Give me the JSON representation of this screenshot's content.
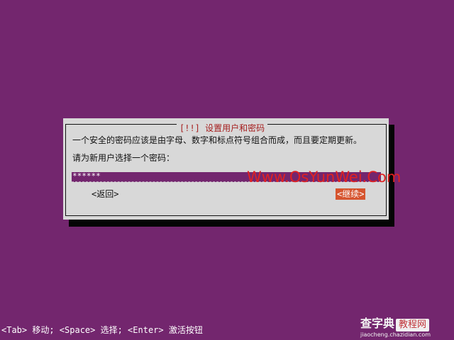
{
  "dialog": {
    "title": "[!!] 设置用户和密码",
    "message": "一个安全的密码应该是由字母、数字和标点符号组合而成，而且要定期更新。",
    "prompt": "请为新用户选择一个密码：",
    "password_value": "******",
    "back_label": "<返回>",
    "continue_label": "<继续>"
  },
  "help_bar": {
    "text": "<Tab> 移动; <Space> 选择; <Enter> 激活按钮"
  },
  "watermark": {
    "text": "Www.OsYunWei.Com"
  },
  "site_logo": {
    "main": "查字典",
    "box": "教程网",
    "sub": "jiaocheng.chazidian.com"
  },
  "colors": {
    "background": "#73266e",
    "dialog": "#d8d8d8",
    "title": "#a51e1e",
    "selected_button": "#d6542e",
    "watermark": "#e02121"
  }
}
